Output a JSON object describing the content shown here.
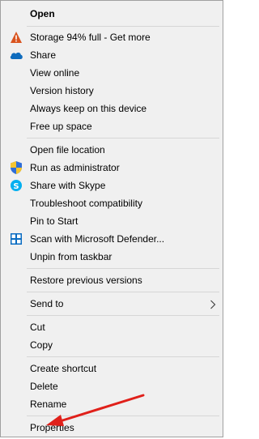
{
  "menu": {
    "items": {
      "open": "Open",
      "storage": "Storage 94% full - Get more",
      "share": "Share",
      "view_online": "View online",
      "version_history": "Version history",
      "always_keep": "Always keep on this device",
      "free_up_space": "Free up space",
      "open_file_location": "Open file location",
      "run_as_admin": "Run as administrator",
      "share_with_skype": "Share with Skype",
      "troubleshoot": "Troubleshoot compatibility",
      "pin_to_start": "Pin to Start",
      "scan_defender": "Scan with Microsoft Defender...",
      "unpin_taskbar": "Unpin from taskbar",
      "restore_versions": "Restore previous versions",
      "send_to": "Send to",
      "cut": "Cut",
      "copy": "Copy",
      "create_shortcut": "Create shortcut",
      "delete": "Delete",
      "rename": "Rename",
      "properties": "Properties"
    }
  },
  "icons": {
    "storage": "warning-triangle-icon",
    "share": "onedrive-cloud-icon",
    "run_as_admin": "uac-shield-icon",
    "share_with_skype": "skype-icon",
    "scan_defender": "defender-icon",
    "send_to": "chevron-right-icon"
  },
  "colors": {
    "menu_background": "#f0f0f0",
    "separator": "#d6d6d6",
    "warning": "#d9531e",
    "onedrive": "#0f6cbd",
    "skype": "#00aff0",
    "defender": "#0a6cc2",
    "annotation_arrow": "#e0201a"
  }
}
